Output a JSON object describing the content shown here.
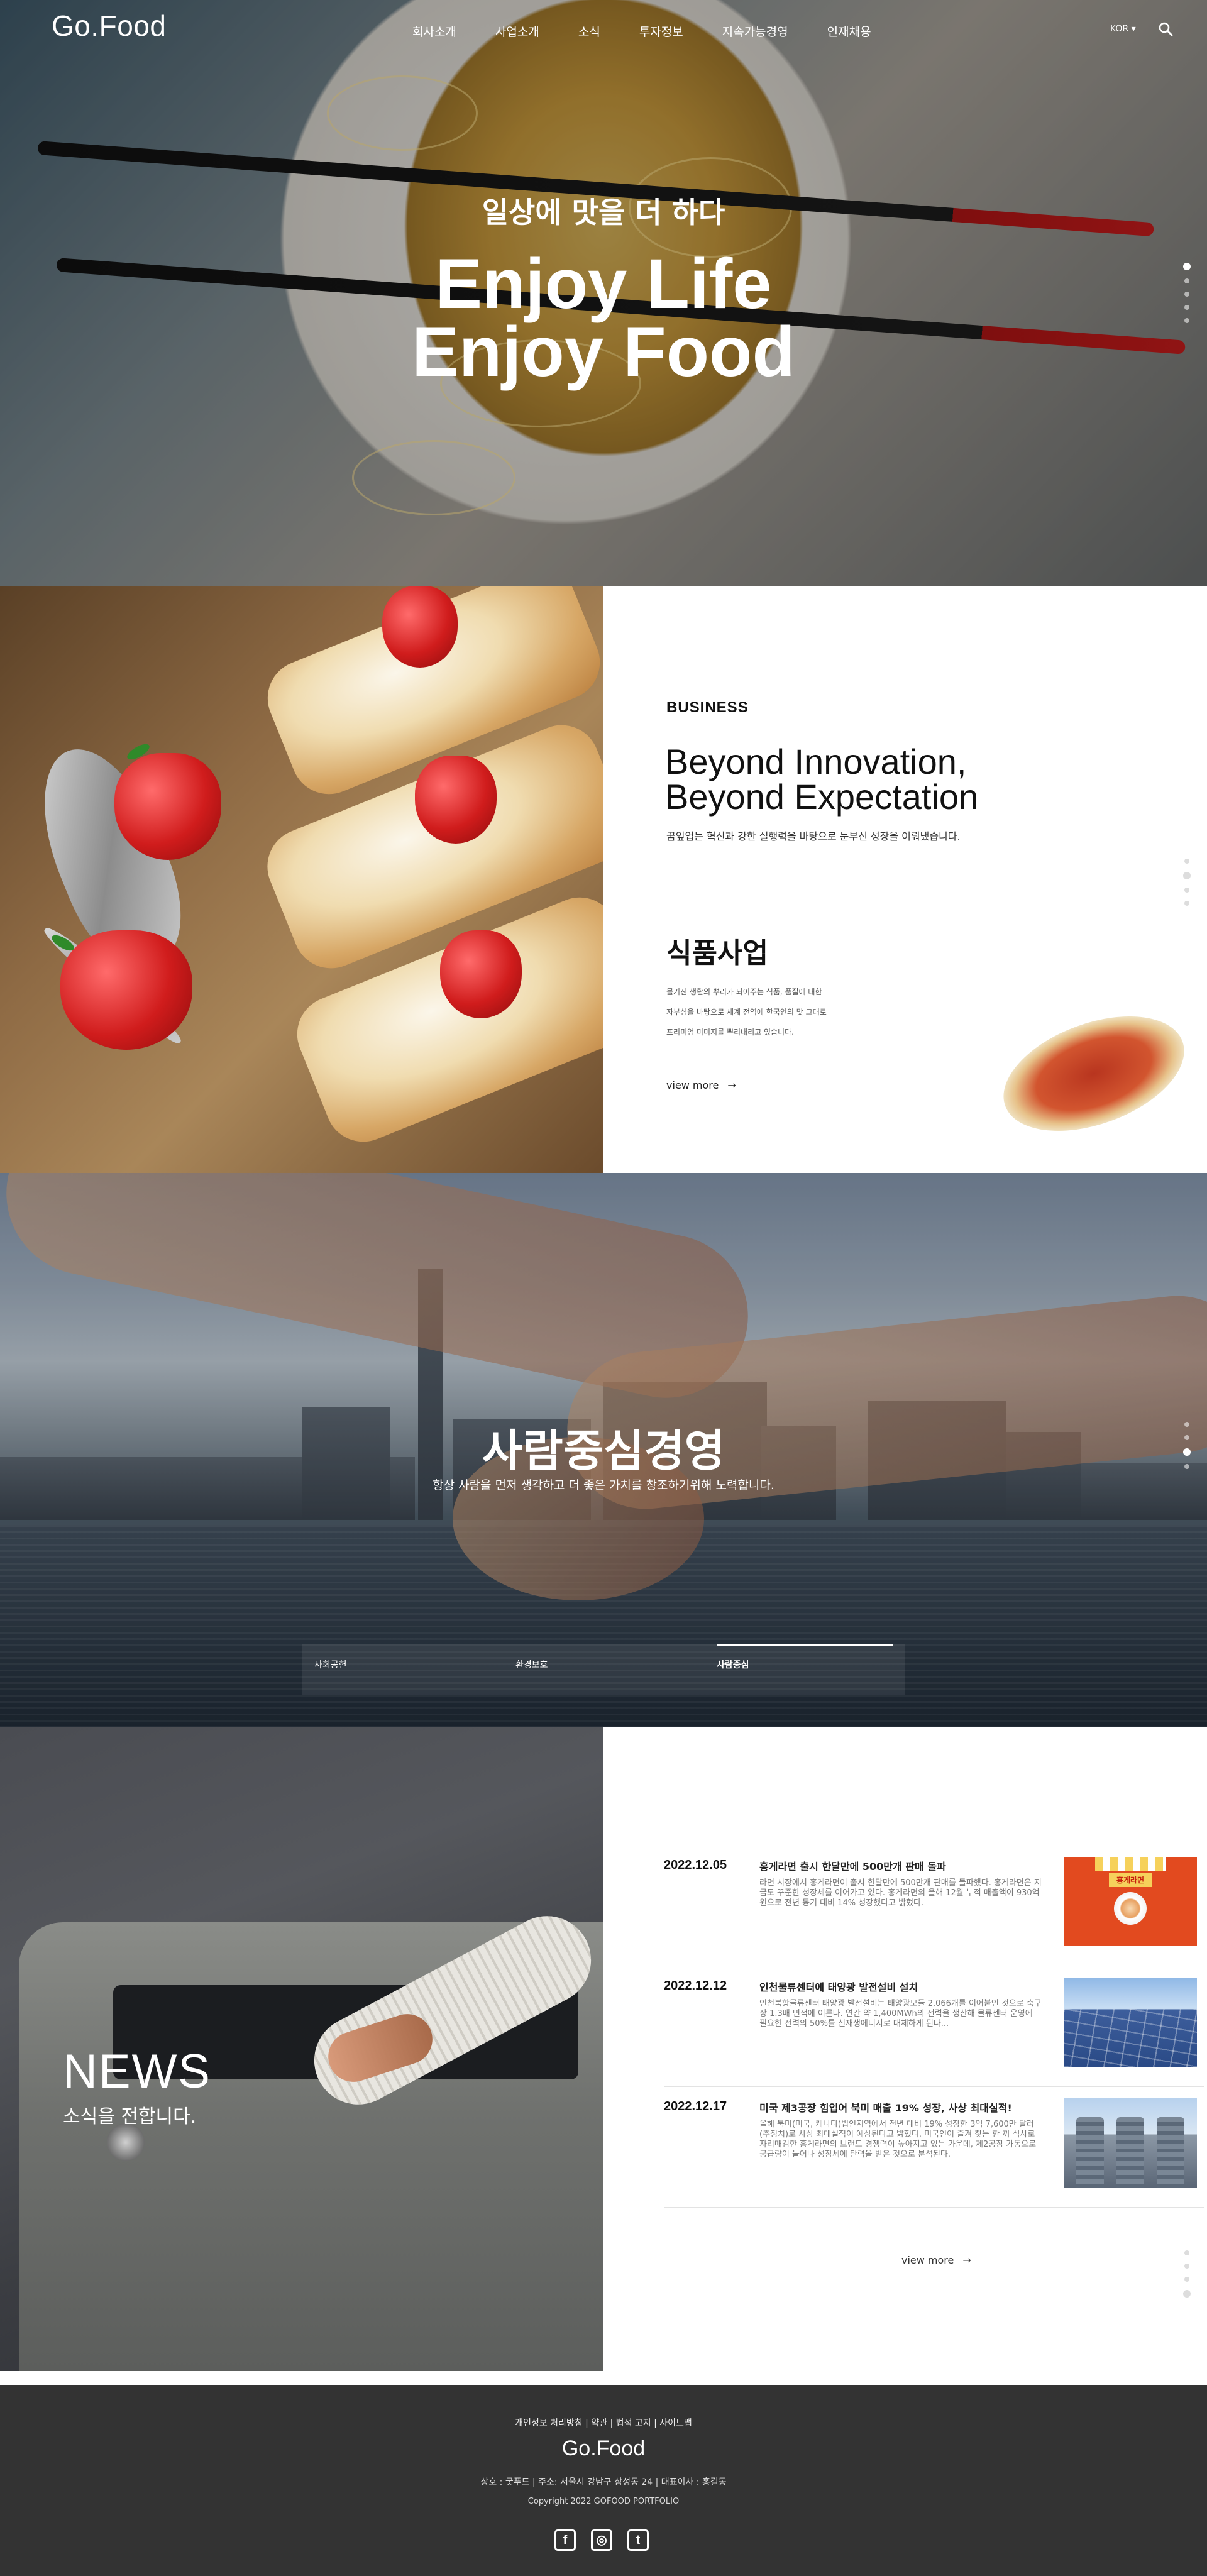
{
  "header": {
    "logo": "Go.Food",
    "nav": [
      "회사소개",
      "사업소개",
      "소식",
      "투자정보",
      "지속가능경영",
      "인재채용"
    ],
    "lang": "KOR ▾",
    "search_icon": "search-icon"
  },
  "hero": {
    "subtitle": "일상에 맛을 더 하다",
    "title_line1": "Enjoy Life",
    "title_line2": "Enjoy Food"
  },
  "business": {
    "label": "BUSINESS",
    "title_line1": "Beyond Innovation,",
    "title_line2": "Beyond Expectation",
    "description": "꿈잎업는 혁신과 강한 실행력을 바탕으로 눈부신 성장을 이뤄냈습니다.",
    "food_title": "식품사업",
    "food_desc_lines": [
      "물기진 생활의 뿌리가 되어주는 식품, 품질에 대한",
      "자부심을 바탕으로 세계 전역에 한국인의 맛 그대로",
      "프리미엄 미미지를 뿌리내리고 있습니다."
    ],
    "view_more": "view more",
    "arrow": "→"
  },
  "people": {
    "title": "사람중심경영",
    "description": "항상 사람을 먼저 생각하고 더 좋은 가치를 창조하기위해 노력합니다.",
    "tabs": [
      "사회공헌",
      "환경보호",
      "사람중심"
    ],
    "active_tab": 2
  },
  "news": {
    "heading": "NEWS",
    "subheading": "소식을 전합니다.",
    "items": [
      {
        "date": "2022.12.05",
        "title": "홍게라면 출시 한달만에 500만개 판매 돌파",
        "desc": "라면 시장에서 홍게라면이 출시 한달만에 500만개 판매를 돌파했다. 홍게라면은 지금도 꾸준한 성장세를 이어가고 있다. 홍게라면의 올해 12월 누적 매출액이 930억 원으로 전년 동기 대비 14% 성장했다고 밝혔다.",
        "thumb_sign": "홍게라면"
      },
      {
        "date": "2022.12.12",
        "title": "인천물류센터에 태양광 발전설비 설치",
        "desc": "인천북항물류센터 태양광 발전설비는 태양광모듈 2,066개를 이어붙인 것으로 축구장 1.3배 면적에 이른다. 연간 약 1,400MWh의 전력을 생산해 물류센터 운영에 필요한 전력의 50%를 신재생에너지로 대체하게 된다..."
      },
      {
        "date": "2022.12.17",
        "title": "미국 제3공장 힘입어 북미 매출 19% 성장, 사상 최대실적!",
        "desc": "올해 북미(미국, 캐나다)법인지역에서 전년 대비 19% 성장한 3억 7,600만 달러(추정치)로 사상 최대실적이 예상된다고 밝혔다. 미국인이 즐겨 찾는 한 끼 식사로 자리매김한 홍게라면의 브랜드 경쟁력이 높아지고 있는 가운데, 제2공장 가동으로 공급량이 늘어나 성장세에 탄력을 받은 것으로 분석된다."
      }
    ],
    "view_more": "view more",
    "arrow": "→"
  },
  "footer": {
    "links": "개인정보 처리방침 | 약관 | 법적 고지 | 사이트맵",
    "logo": "Go.Food",
    "info": "상호 : 굿푸드 | 주소: 서울시 강남구 삼성동 24 | 대표이사 : 홍길동",
    "copyright": "Copyright 2022 GOFOOD PORTFOLIO",
    "social": [
      {
        "name": "facebook-icon",
        "glyph": "f"
      },
      {
        "name": "instagram-icon",
        "glyph": "◎"
      },
      {
        "name": "twitter-icon",
        "glyph": "t"
      }
    ]
  }
}
